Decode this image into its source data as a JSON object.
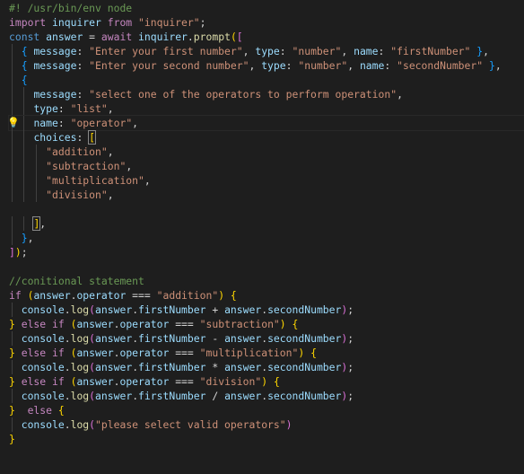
{
  "editor": {
    "background": "#1e1e1e",
    "lightbulb_icon": "lightbulb-icon",
    "active_line": 8,
    "lines": [
      [
        {
          "t": "#! /usr/bin/env node",
          "c": "comment"
        }
      ],
      [
        {
          "t": "import",
          "c": "keyword"
        },
        {
          "t": " inquirer ",
          "c": "var"
        },
        {
          "t": "from",
          "c": "keyword"
        },
        {
          "t": " ",
          "c": "plain"
        },
        {
          "t": "\"inquirer\"",
          "c": "string"
        },
        {
          "t": ";",
          "c": "plain"
        }
      ],
      [
        {
          "t": "const",
          "c": "storage"
        },
        {
          "t": " answer ",
          "c": "var"
        },
        {
          "t": "= ",
          "c": "plain"
        },
        {
          "t": "await",
          "c": "keyword"
        },
        {
          "t": " ",
          "c": "plain"
        },
        {
          "t": "inquirer",
          "c": "var"
        },
        {
          "t": ".",
          "c": "plain"
        },
        {
          "t": "prompt",
          "c": "func"
        },
        {
          "t": "(",
          "c": "b1"
        },
        {
          "t": "[",
          "c": "b2"
        }
      ],
      [
        {
          "t": "  ",
          "c": "plain"
        },
        {
          "t": "{",
          "c": "b3"
        },
        {
          "t": " ",
          "c": "plain"
        },
        {
          "t": "message",
          "c": "var"
        },
        {
          "t": ": ",
          "c": "plain"
        },
        {
          "t": "\"Enter your first number\"",
          "c": "string"
        },
        {
          "t": ", ",
          "c": "plain"
        },
        {
          "t": "type",
          "c": "var"
        },
        {
          "t": ": ",
          "c": "plain"
        },
        {
          "t": "\"number\"",
          "c": "string"
        },
        {
          "t": ", ",
          "c": "plain"
        },
        {
          "t": "name",
          "c": "var"
        },
        {
          "t": ": ",
          "c": "plain"
        },
        {
          "t": "\"firstNumber\"",
          "c": "string"
        },
        {
          "t": " ",
          "c": "plain"
        },
        {
          "t": "}",
          "c": "b3"
        },
        {
          "t": ",",
          "c": "plain"
        }
      ],
      [
        {
          "t": "  ",
          "c": "plain"
        },
        {
          "t": "{",
          "c": "b3"
        },
        {
          "t": " ",
          "c": "plain"
        },
        {
          "t": "message",
          "c": "var"
        },
        {
          "t": ": ",
          "c": "plain"
        },
        {
          "t": "\"Enter your second number\"",
          "c": "string"
        },
        {
          "t": ", ",
          "c": "plain"
        },
        {
          "t": "type",
          "c": "var"
        },
        {
          "t": ": ",
          "c": "plain"
        },
        {
          "t": "\"number\"",
          "c": "string"
        },
        {
          "t": ", ",
          "c": "plain"
        },
        {
          "t": "name",
          "c": "var"
        },
        {
          "t": ": ",
          "c": "plain"
        },
        {
          "t": "\"secondNumber\"",
          "c": "string"
        },
        {
          "t": " ",
          "c": "plain"
        },
        {
          "t": "}",
          "c": "b3"
        },
        {
          "t": ",",
          "c": "plain"
        }
      ],
      [
        {
          "t": "  ",
          "c": "plain"
        },
        {
          "t": "{",
          "c": "b3"
        }
      ],
      [
        {
          "t": "    ",
          "c": "plain"
        },
        {
          "t": "message",
          "c": "var"
        },
        {
          "t": ": ",
          "c": "plain"
        },
        {
          "t": "\"select one of the operators to perform operation\"",
          "c": "string"
        },
        {
          "t": ",",
          "c": "plain"
        }
      ],
      [
        {
          "t": "    ",
          "c": "plain"
        },
        {
          "t": "type",
          "c": "var"
        },
        {
          "t": ": ",
          "c": "plain"
        },
        {
          "t": "\"list\"",
          "c": "string"
        },
        {
          "t": ",",
          "c": "plain"
        }
      ],
      [
        {
          "t": "    ",
          "c": "plain"
        },
        {
          "t": "name",
          "c": "var"
        },
        {
          "t": ": ",
          "c": "plain"
        },
        {
          "t": "\"operator\"",
          "c": "string"
        },
        {
          "t": ",",
          "c": "plain"
        }
      ],
      [
        {
          "t": "    ",
          "c": "plain"
        },
        {
          "t": "choices",
          "c": "var"
        },
        {
          "t": ": ",
          "c": "plain"
        },
        {
          "t": "[",
          "c": "b1",
          "box": true
        }
      ],
      [
        {
          "t": "      ",
          "c": "plain"
        },
        {
          "t": "\"addition\"",
          "c": "string"
        },
        {
          "t": ",",
          "c": "plain"
        }
      ],
      [
        {
          "t": "      ",
          "c": "plain"
        },
        {
          "t": "\"subtraction\"",
          "c": "string"
        },
        {
          "t": ",",
          "c": "plain"
        }
      ],
      [
        {
          "t": "      ",
          "c": "plain"
        },
        {
          "t": "\"multiplication\"",
          "c": "string"
        },
        {
          "t": ",",
          "c": "plain"
        }
      ],
      [
        {
          "t": "      ",
          "c": "plain"
        },
        {
          "t": "\"division\"",
          "c": "string"
        },
        {
          "t": ",",
          "c": "plain"
        }
      ],
      [
        {
          "t": "",
          "c": "plain"
        }
      ],
      [
        {
          "t": "    ",
          "c": "plain"
        },
        {
          "t": "]",
          "c": "b1",
          "box": true
        },
        {
          "t": ",",
          "c": "plain"
        }
      ],
      [
        {
          "t": "  ",
          "c": "plain"
        },
        {
          "t": "}",
          "c": "b3"
        },
        {
          "t": ",",
          "c": "plain"
        }
      ],
      [
        {
          "t": "]",
          "c": "b2"
        },
        {
          "t": ")",
          "c": "b1"
        },
        {
          "t": ";",
          "c": "plain"
        }
      ],
      [
        {
          "t": "",
          "c": "plain"
        }
      ],
      [
        {
          "t": "//conitional statement",
          "c": "comment"
        }
      ],
      [
        {
          "t": "if",
          "c": "keyword"
        },
        {
          "t": " ",
          "c": "plain"
        },
        {
          "t": "(",
          "c": "b1"
        },
        {
          "t": "answer",
          "c": "var"
        },
        {
          "t": ".",
          "c": "plain"
        },
        {
          "t": "operator",
          "c": "var"
        },
        {
          "t": " === ",
          "c": "plain"
        },
        {
          "t": "\"addition\"",
          "c": "string"
        },
        {
          "t": ")",
          "c": "b1"
        },
        {
          "t": " ",
          "c": "plain"
        },
        {
          "t": "{",
          "c": "b1"
        }
      ],
      [
        {
          "t": "  ",
          "c": "plain"
        },
        {
          "t": "console",
          "c": "var"
        },
        {
          "t": ".",
          "c": "plain"
        },
        {
          "t": "log",
          "c": "func"
        },
        {
          "t": "(",
          "c": "b2"
        },
        {
          "t": "answer",
          "c": "var"
        },
        {
          "t": ".",
          "c": "plain"
        },
        {
          "t": "firstNumber",
          "c": "var"
        },
        {
          "t": " + ",
          "c": "plain"
        },
        {
          "t": "answer",
          "c": "var"
        },
        {
          "t": ".",
          "c": "plain"
        },
        {
          "t": "secondNumber",
          "c": "var"
        },
        {
          "t": ")",
          "c": "b2"
        },
        {
          "t": ";",
          "c": "plain"
        }
      ],
      [
        {
          "t": "}",
          "c": "b1"
        },
        {
          "t": " ",
          "c": "plain"
        },
        {
          "t": "else",
          "c": "keyword"
        },
        {
          "t": " ",
          "c": "plain"
        },
        {
          "t": "if",
          "c": "keyword"
        },
        {
          "t": " ",
          "c": "plain"
        },
        {
          "t": "(",
          "c": "b1"
        },
        {
          "t": "answer",
          "c": "var"
        },
        {
          "t": ".",
          "c": "plain"
        },
        {
          "t": "operator",
          "c": "var"
        },
        {
          "t": " === ",
          "c": "plain"
        },
        {
          "t": "\"subtraction\"",
          "c": "string"
        },
        {
          "t": ")",
          "c": "b1"
        },
        {
          "t": " ",
          "c": "plain"
        },
        {
          "t": "{",
          "c": "b1"
        }
      ],
      [
        {
          "t": "  ",
          "c": "plain"
        },
        {
          "t": "console",
          "c": "var"
        },
        {
          "t": ".",
          "c": "plain"
        },
        {
          "t": "log",
          "c": "func"
        },
        {
          "t": "(",
          "c": "b2"
        },
        {
          "t": "answer",
          "c": "var"
        },
        {
          "t": ".",
          "c": "plain"
        },
        {
          "t": "firstNumber",
          "c": "var"
        },
        {
          "t": " - ",
          "c": "plain"
        },
        {
          "t": "answer",
          "c": "var"
        },
        {
          "t": ".",
          "c": "plain"
        },
        {
          "t": "secondNumber",
          "c": "var"
        },
        {
          "t": ")",
          "c": "b2"
        },
        {
          "t": ";",
          "c": "plain"
        }
      ],
      [
        {
          "t": "}",
          "c": "b1"
        },
        {
          "t": " ",
          "c": "plain"
        },
        {
          "t": "else",
          "c": "keyword"
        },
        {
          "t": " ",
          "c": "plain"
        },
        {
          "t": "if",
          "c": "keyword"
        },
        {
          "t": " ",
          "c": "plain"
        },
        {
          "t": "(",
          "c": "b1"
        },
        {
          "t": "answer",
          "c": "var"
        },
        {
          "t": ".",
          "c": "plain"
        },
        {
          "t": "operator",
          "c": "var"
        },
        {
          "t": " === ",
          "c": "plain"
        },
        {
          "t": "\"multiplication\"",
          "c": "string"
        },
        {
          "t": ")",
          "c": "b1"
        },
        {
          "t": " ",
          "c": "plain"
        },
        {
          "t": "{",
          "c": "b1"
        }
      ],
      [
        {
          "t": "  ",
          "c": "plain"
        },
        {
          "t": "console",
          "c": "var"
        },
        {
          "t": ".",
          "c": "plain"
        },
        {
          "t": "log",
          "c": "func"
        },
        {
          "t": "(",
          "c": "b2"
        },
        {
          "t": "answer",
          "c": "var"
        },
        {
          "t": ".",
          "c": "plain"
        },
        {
          "t": "firstNumber",
          "c": "var"
        },
        {
          "t": " * ",
          "c": "plain"
        },
        {
          "t": "answer",
          "c": "var"
        },
        {
          "t": ".",
          "c": "plain"
        },
        {
          "t": "secondNumber",
          "c": "var"
        },
        {
          "t": ")",
          "c": "b2"
        },
        {
          "t": ";",
          "c": "plain"
        }
      ],
      [
        {
          "t": "}",
          "c": "b1"
        },
        {
          "t": " ",
          "c": "plain"
        },
        {
          "t": "else",
          "c": "keyword"
        },
        {
          "t": " ",
          "c": "plain"
        },
        {
          "t": "if",
          "c": "keyword"
        },
        {
          "t": " ",
          "c": "plain"
        },
        {
          "t": "(",
          "c": "b1"
        },
        {
          "t": "answer",
          "c": "var"
        },
        {
          "t": ".",
          "c": "plain"
        },
        {
          "t": "operator",
          "c": "var"
        },
        {
          "t": " === ",
          "c": "plain"
        },
        {
          "t": "\"division\"",
          "c": "string"
        },
        {
          "t": ")",
          "c": "b1"
        },
        {
          "t": " ",
          "c": "plain"
        },
        {
          "t": "{",
          "c": "b1"
        }
      ],
      [
        {
          "t": "  ",
          "c": "plain"
        },
        {
          "t": "console",
          "c": "var"
        },
        {
          "t": ".",
          "c": "plain"
        },
        {
          "t": "log",
          "c": "func"
        },
        {
          "t": "(",
          "c": "b2"
        },
        {
          "t": "answer",
          "c": "var"
        },
        {
          "t": ".",
          "c": "plain"
        },
        {
          "t": "firstNumber",
          "c": "var"
        },
        {
          "t": " / ",
          "c": "plain"
        },
        {
          "t": "answer",
          "c": "var"
        },
        {
          "t": ".",
          "c": "plain"
        },
        {
          "t": "secondNumber",
          "c": "var"
        },
        {
          "t": ")",
          "c": "b2"
        },
        {
          "t": ";",
          "c": "plain"
        }
      ],
      [
        {
          "t": "}",
          "c": "b1"
        },
        {
          "t": "  ",
          "c": "plain"
        },
        {
          "t": "else",
          "c": "keyword"
        },
        {
          "t": " ",
          "c": "plain"
        },
        {
          "t": "{",
          "c": "b1"
        }
      ],
      [
        {
          "t": "  ",
          "c": "plain"
        },
        {
          "t": "console",
          "c": "var"
        },
        {
          "t": ".",
          "c": "plain"
        },
        {
          "t": "log",
          "c": "func"
        },
        {
          "t": "(",
          "c": "b2"
        },
        {
          "t": "\"please select valid operators\"",
          "c": "string"
        },
        {
          "t": ")",
          "c": "b2"
        }
      ],
      [
        {
          "t": "}",
          "c": "b1"
        }
      ]
    ]
  }
}
